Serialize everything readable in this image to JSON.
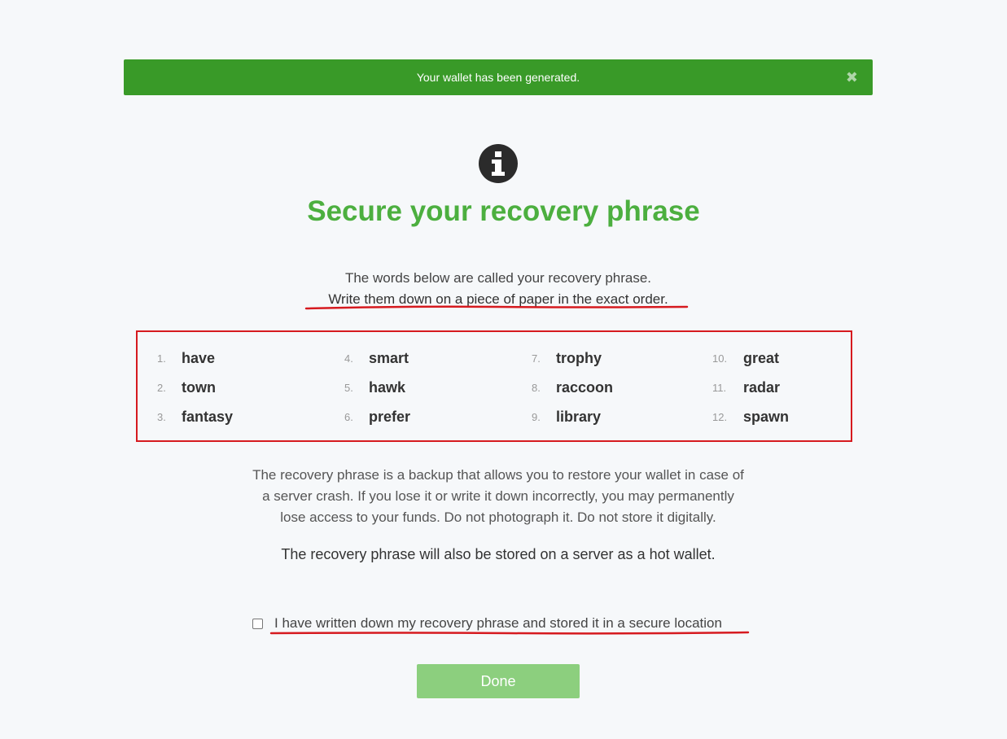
{
  "alert": {
    "message": "Your wallet has been generated.",
    "close_icon": "close-icon",
    "color": "#399a28"
  },
  "header": {
    "icon": "info-icon",
    "title": "Secure your recovery phrase",
    "title_color": "#4caf3f"
  },
  "intro": {
    "line1": "The words below are called your recovery phrase.",
    "line2": "Write them down on a piece of paper in the exact order."
  },
  "phrase": {
    "words": [
      {
        "num": "1.",
        "word": "have"
      },
      {
        "num": "2.",
        "word": "town"
      },
      {
        "num": "3.",
        "word": "fantasy"
      },
      {
        "num": "4.",
        "word": "smart"
      },
      {
        "num": "5.",
        "word": "hawk"
      },
      {
        "num": "6.",
        "word": "prefer"
      },
      {
        "num": "7.",
        "word": "trophy"
      },
      {
        "num": "8.",
        "word": "raccoon"
      },
      {
        "num": "9.",
        "word": "library"
      },
      {
        "num": "10.",
        "word": "great"
      },
      {
        "num": "11.",
        "word": "radar"
      },
      {
        "num": "12.",
        "word": "spawn"
      }
    ]
  },
  "warning": {
    "line1": "The recovery phrase is a backup that allows you to restore your wallet in case of",
    "line2": "a server crash. If you lose it or write it down incorrectly, you may permanently",
    "line3": "lose access to your funds. Do not photograph it. Do not store it digitally."
  },
  "hot_wallet_note": "The recovery phrase will also be stored on a server as a hot wallet.",
  "confirm": {
    "label": "I have written down my recovery phrase and stored it in a secure location",
    "checked": false
  },
  "done_button": {
    "label": "Done",
    "color": "#8ccf7e"
  },
  "annotation_color": "#d61a1f"
}
